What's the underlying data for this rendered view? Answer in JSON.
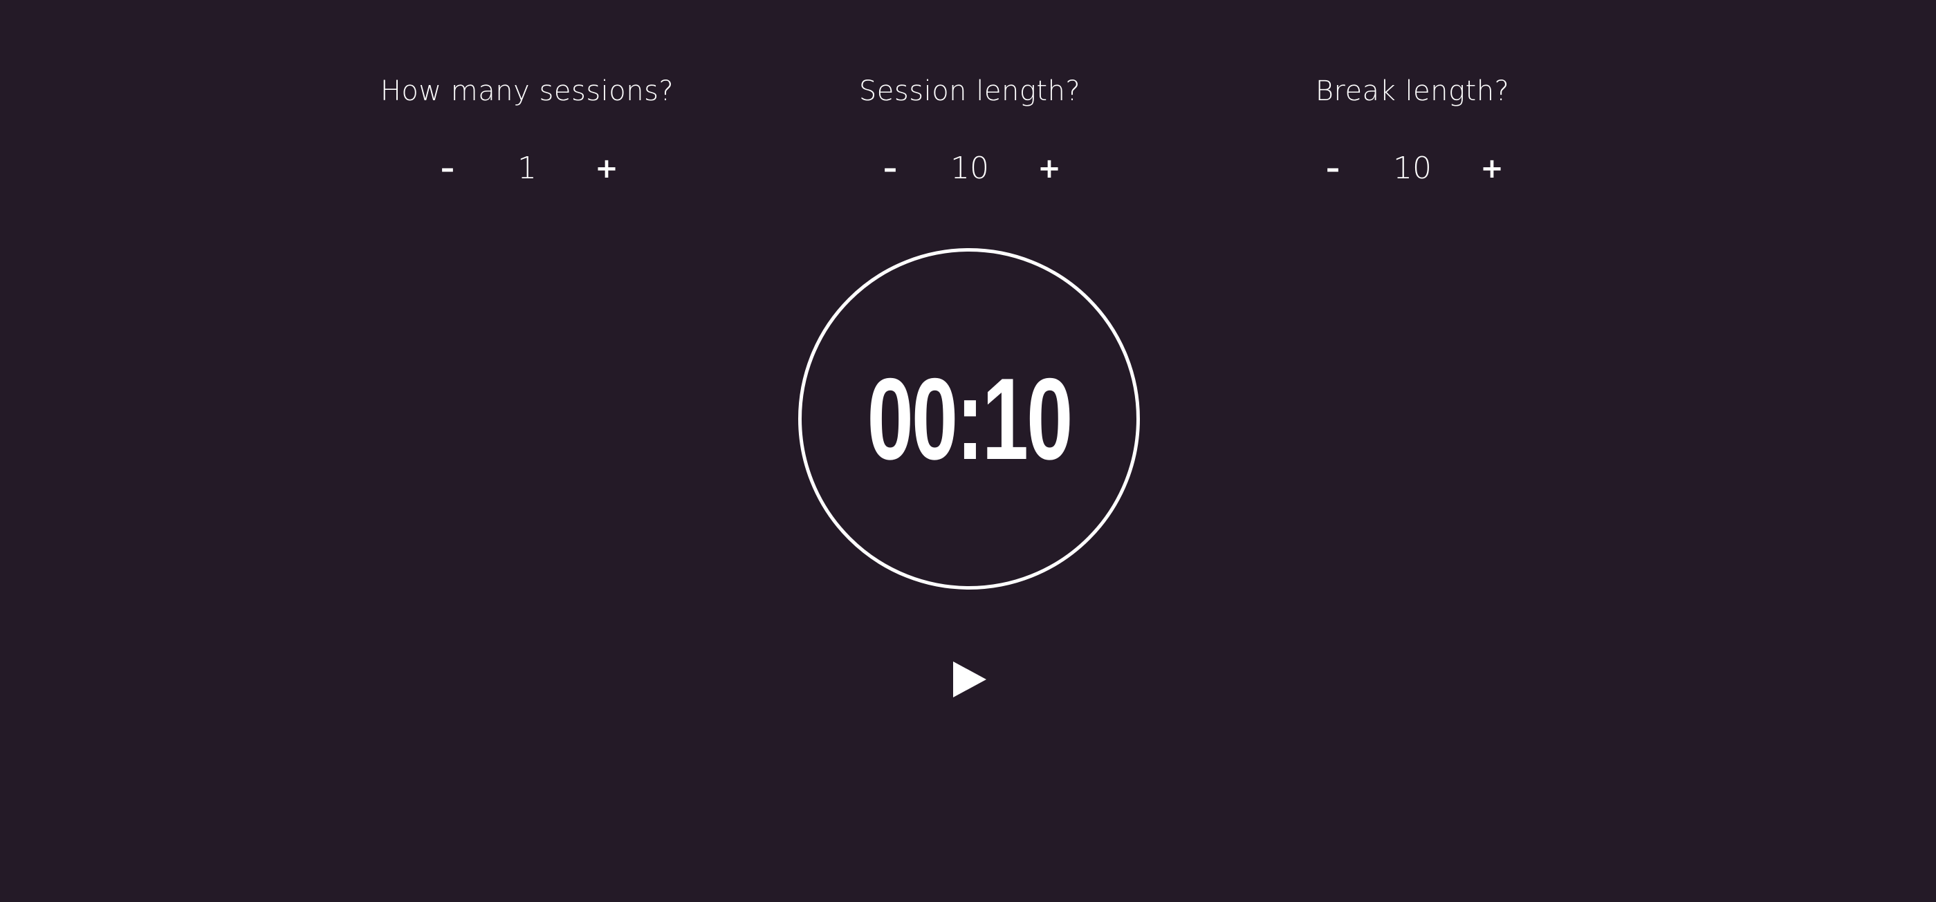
{
  "controls": [
    {
      "label": "How many sessions?",
      "minus": "–",
      "value": "1",
      "plus": "+"
    },
    {
      "label": "Session length?",
      "minus": "–",
      "value": "10",
      "plus": "+"
    },
    {
      "label": "Break length?",
      "minus": "–",
      "value": "10",
      "plus": "+"
    }
  ],
  "timer": {
    "display": "00:10"
  },
  "play": {
    "icon": "play-icon"
  },
  "colors": {
    "background": "#241a27",
    "foreground": "#ffffff"
  }
}
